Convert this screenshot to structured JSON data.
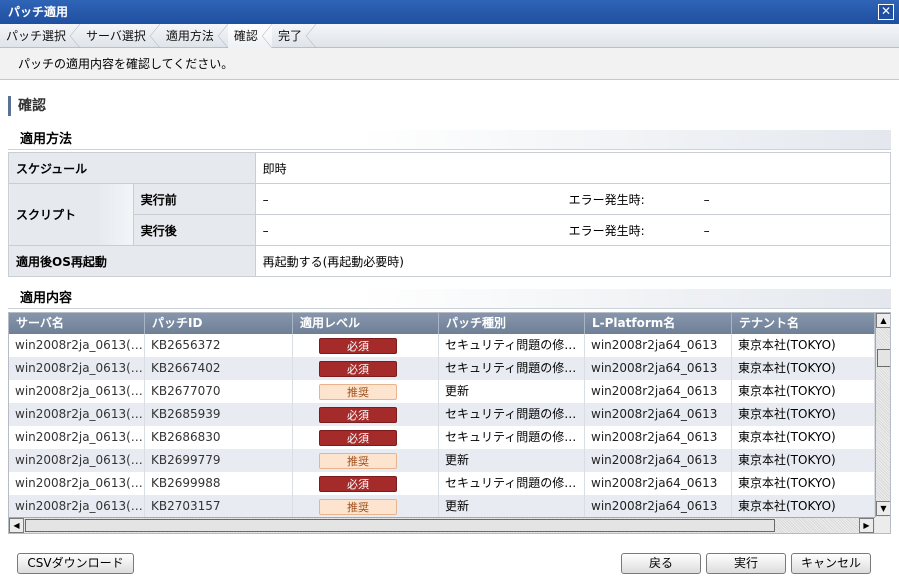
{
  "window": {
    "title": "パッチ適用",
    "close_glyph": "✕"
  },
  "breadcrumb": [
    {
      "label": "パッチ選択"
    },
    {
      "label": "サーバ選択"
    },
    {
      "label": "適用方法"
    },
    {
      "label": "確認"
    },
    {
      "label": "完了"
    }
  ],
  "instruction": "パッチの適用内容を確認してください。",
  "heading": "確認",
  "method": {
    "title": "適用方法",
    "schedule_label": "スケジュール",
    "schedule_value": "即時",
    "script_label": "スクリプト",
    "before_label": "実行前",
    "before_value": "–",
    "before_err_label": "エラー発生時:",
    "before_err_value": "–",
    "after_label": "実行後",
    "after_value": "–",
    "after_err_label": "エラー発生時:",
    "after_err_value": "–",
    "reboot_label": "適用後OS再起動",
    "reboot_value": "再起動する(再起動必要時)"
  },
  "content": {
    "title": "適用内容",
    "columns": [
      "サーバ名",
      "パッチID",
      "適用レベル",
      "パッチ種別",
      "L-Platform名",
      "テナント名"
    ],
    "rows": [
      {
        "server": "win2008r2ja_0613(…",
        "patch_id": "KB2656372",
        "level": "必須",
        "type": "セキュリティ問題の修…",
        "lplatform": "win2008r2ja64_0613",
        "tenant": "東京本社(TOKYO)"
      },
      {
        "server": "win2008r2ja_0613(…",
        "patch_id": "KB2667402",
        "level": "必須",
        "type": "セキュリティ問題の修…",
        "lplatform": "win2008r2ja64_0613",
        "tenant": "東京本社(TOKYO)"
      },
      {
        "server": "win2008r2ja_0613(…",
        "patch_id": "KB2677070",
        "level": "推奨",
        "type": "更新",
        "lplatform": "win2008r2ja64_0613",
        "tenant": "東京本社(TOKYO)"
      },
      {
        "server": "win2008r2ja_0613(…",
        "patch_id": "KB2685939",
        "level": "必須",
        "type": "セキュリティ問題の修…",
        "lplatform": "win2008r2ja64_0613",
        "tenant": "東京本社(TOKYO)"
      },
      {
        "server": "win2008r2ja_0613(…",
        "patch_id": "KB2686830",
        "level": "必須",
        "type": "セキュリティ問題の修…",
        "lplatform": "win2008r2ja64_0613",
        "tenant": "東京本社(TOKYO)"
      },
      {
        "server": "win2008r2ja_0613(…",
        "patch_id": "KB2699779",
        "level": "推奨",
        "type": "更新",
        "lplatform": "win2008r2ja64_0613",
        "tenant": "東京本社(TOKYO)"
      },
      {
        "server": "win2008r2ja_0613(…",
        "patch_id": "KB2699988",
        "level": "必須",
        "type": "セキュリティ問題の修…",
        "lplatform": "win2008r2ja64_0613",
        "tenant": "東京本社(TOKYO)"
      },
      {
        "server": "win2008r2ja_0613(…",
        "patch_id": "KB2703157",
        "level": "推奨",
        "type": "更新",
        "lplatform": "win2008r2ja64_0613",
        "tenant": "東京本社(TOKYO)"
      }
    ]
  },
  "buttons": {
    "csv": "CSVダウンロード",
    "back": "戻る",
    "execute": "実行",
    "cancel": "キャンセル"
  },
  "scroll_glyphs": {
    "up": "▲",
    "down": "▼",
    "left": "◀",
    "right": "▶"
  },
  "colors": {
    "required_badge": "#a52b2b",
    "recommended_badge": "#fde4cf",
    "title_bar": "#2f64b6"
  }
}
